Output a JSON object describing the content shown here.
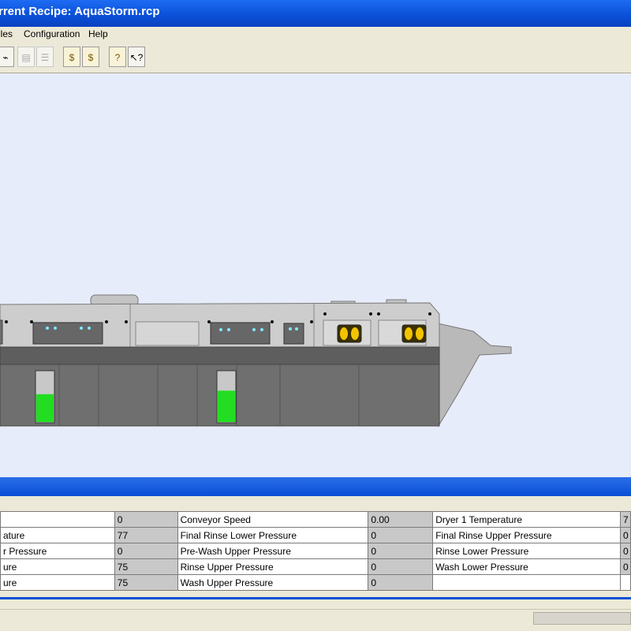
{
  "window": {
    "title": "rrent Recipe: AquaStorm.rcp"
  },
  "menu": [
    "iles",
    "Configuration",
    "Help"
  ],
  "toolbar": {
    "buttons": [
      {
        "name": "chart-icon",
        "glyph": "⌁"
      },
      {
        "name": "disabled-tool-icon",
        "glyph": "▤"
      },
      {
        "name": "disabled-list-icon",
        "glyph": "☰"
      },
      {
        "name": "money-bag-icon",
        "glyph": "$"
      },
      {
        "name": "money-bag-icon-2",
        "glyph": "$"
      },
      {
        "name": "help-icon",
        "glyph": "?"
      },
      {
        "name": "context-help-icon",
        "glyph": "↖?"
      }
    ]
  },
  "machine": {
    "tank_levels": [
      0.55,
      0.62
    ]
  },
  "params": {
    "rows": [
      [
        {
          "n": "",
          "v": "0"
        },
        {
          "n": "Conveyor Speed",
          "v": "0.00"
        },
        {
          "n": "Dryer 1 Temperature",
          "v": "7"
        }
      ],
      [
        {
          "n": "ature",
          "v": "77"
        },
        {
          "n": "Final Rinse Lower Pressure",
          "v": "0"
        },
        {
          "n": "Final Rinse Upper Pressure",
          "v": "0"
        }
      ],
      [
        {
          "n": "r Pressure",
          "v": "0"
        },
        {
          "n": "Pre-Wash Upper Pressure",
          "v": "0"
        },
        {
          "n": "Rinse Lower Pressure",
          "v": "0"
        }
      ],
      [
        {
          "n": "ure",
          "v": "75"
        },
        {
          "n": "Rinse Upper Pressure",
          "v": "0"
        },
        {
          "n": "Wash Lower Pressure",
          "v": "0"
        }
      ],
      [
        {
          "n": "ure",
          "v": "75"
        },
        {
          "n": "Wash Upper Pressure",
          "v": "0"
        },
        {
          "n": "",
          "v": ""
        }
      ]
    ]
  },
  "colors": {
    "titlebar": "#0a4fd6",
    "level": "#22dd22",
    "canvas": "#e7ecfa"
  }
}
